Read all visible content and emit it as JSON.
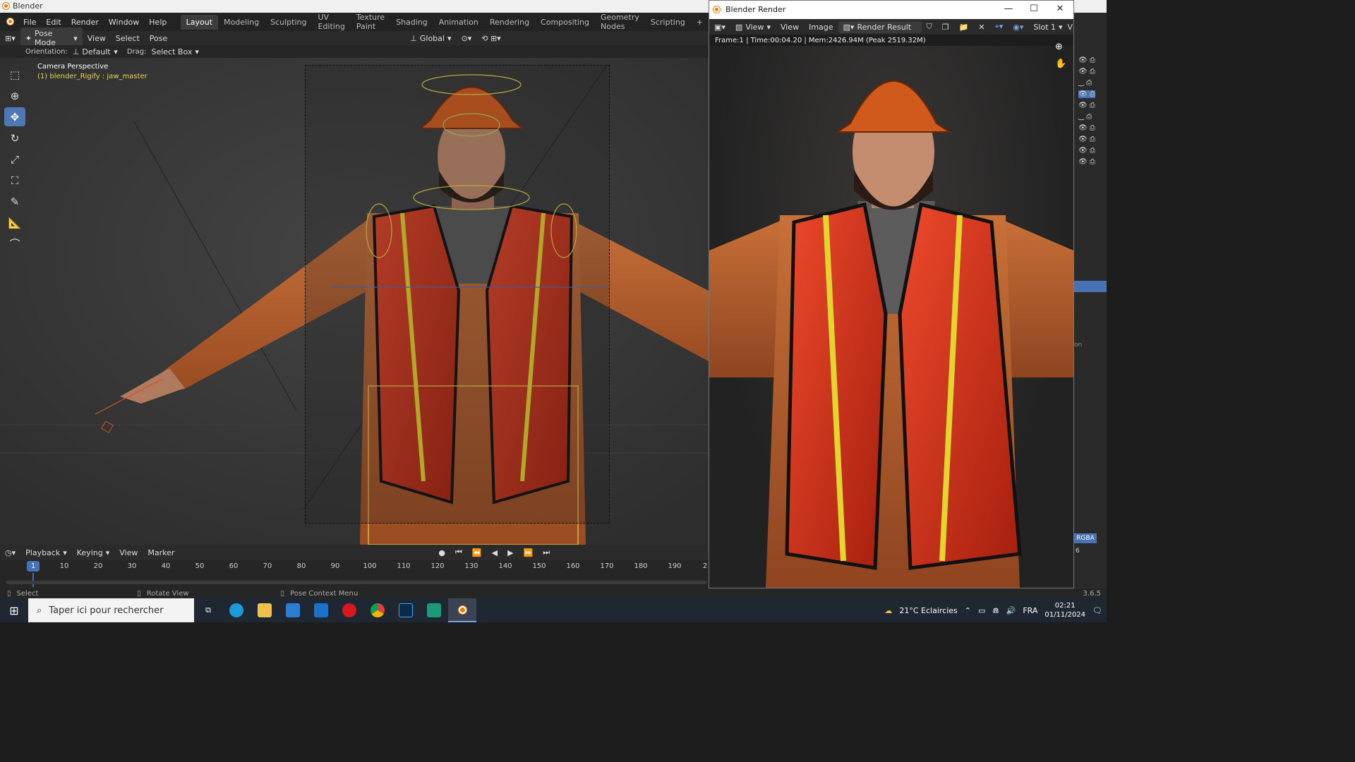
{
  "os_window": {
    "title": "Blender"
  },
  "top_menu": {
    "items": [
      "File",
      "Edit",
      "Render",
      "Window",
      "Help"
    ],
    "workspaces": [
      "Layout",
      "Modeling",
      "Sculpting",
      "UV Editing",
      "Texture Paint",
      "Shading",
      "Animation",
      "Rendering",
      "Compositing",
      "Geometry Nodes",
      "Scripting"
    ],
    "active_workspace": "Layout",
    "add_tab": "+"
  },
  "viewport_header": {
    "mode": "Pose Mode",
    "menus": [
      "View",
      "Select",
      "Pose"
    ],
    "transform_orientation": "Global",
    "orientation_label": "Orientation:",
    "orientation_value": "Default",
    "drag_label": "Drag:",
    "drag_value": "Select Box"
  },
  "viewport": {
    "view_name": "Camera Perspective",
    "active_object": "(1) blender_Rigify : jaw_master",
    "tools": [
      "select-box",
      "cursor",
      "move",
      "rotate",
      "scale",
      "transform",
      "annotate",
      "measure",
      "relax"
    ]
  },
  "timeline": {
    "menus": [
      "Playback",
      "Keying",
      "View",
      "Marker"
    ],
    "current_frame": "1",
    "ticks": [
      "10",
      "20",
      "30",
      "40",
      "50",
      "60",
      "70",
      "80",
      "90",
      "100",
      "110",
      "120",
      "130",
      "140",
      "150",
      "160",
      "170",
      "180",
      "190",
      "2"
    ]
  },
  "statusbar": {
    "select": "Select",
    "rotate": "Rotate View",
    "context": "Pose Context Menu",
    "version": "3.6.5"
  },
  "render_window": {
    "title": "Blender Render",
    "menus": [
      "View",
      "View",
      "Image"
    ],
    "result": "Render Result",
    "slot": "Slot 1",
    "slot_suffix": "V",
    "info": "Frame:1 | Time:00:04.20 | Mem:2426.94M (Peak 2519.32M)",
    "controls": {
      "minimize": "—",
      "maximize": "☐",
      "close": "✕"
    }
  },
  "right_strip": {
    "partial_label": "on",
    "partial_label2": "RGBA",
    "partial_value": "6"
  },
  "taskbar": {
    "search_placeholder": "Taper ici pour rechercher",
    "weather": "21°C  Eclaircies",
    "language": "FRA",
    "time": "02:21",
    "date": "01/11/2024"
  },
  "colors": {
    "accent": "#4772b3",
    "rig_yellow": "#e9d64c",
    "blender_orange": "#e87d0d"
  }
}
